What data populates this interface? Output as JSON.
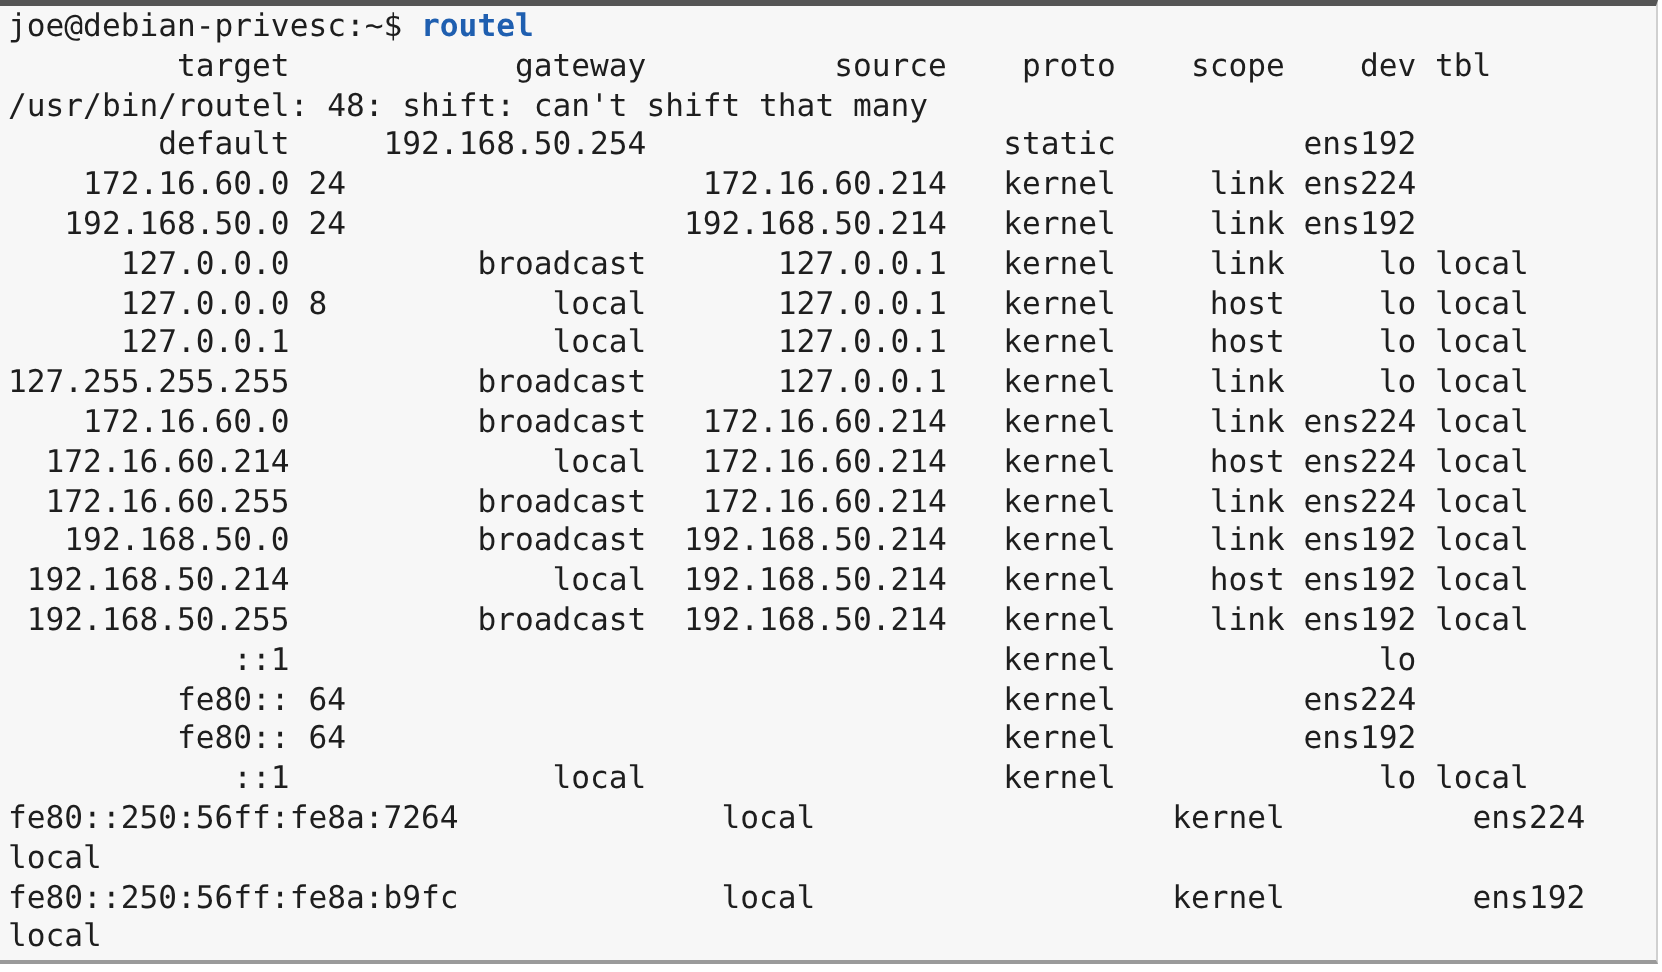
{
  "terminal": {
    "prompt": "joe@debian-privesc:~$",
    "command": "routel",
    "lines": [
      "         target            gateway          source    proto    scope    dev tbl",
      "/usr/bin/routel: 48: shift: can't shift that many",
      "        default     192.168.50.254                   static          ens192",
      "    172.16.60.0 24                   172.16.60.214   kernel     link ens224",
      "   192.168.50.0 24                  192.168.50.214   kernel     link ens192",
      "      127.0.0.0          broadcast       127.0.0.1   kernel     link     lo local",
      "      127.0.0.0 8            local       127.0.0.1   kernel     host     lo local",
      "      127.0.0.1              local       127.0.0.1   kernel     host     lo local",
      "127.255.255.255          broadcast       127.0.0.1   kernel     link     lo local",
      "    172.16.60.0          broadcast   172.16.60.214   kernel     link ens224 local",
      "  172.16.60.214              local   172.16.60.214   kernel     host ens224 local",
      "  172.16.60.255          broadcast   172.16.60.214   kernel     link ens224 local",
      "   192.168.50.0          broadcast  192.168.50.214   kernel     link ens192 local",
      " 192.168.50.214              local  192.168.50.214   kernel     host ens192 local",
      " 192.168.50.255          broadcast  192.168.50.214   kernel     link ens192 local",
      "            ::1                                      kernel              lo",
      "         fe80:: 64                                   kernel          ens224",
      "         fe80:: 64                                   kernel          ens192",
      "            ::1              local                   kernel              lo local",
      "fe80::250:56ff:fe8a:7264              local                   kernel          ens224",
      "local",
      "fe80::250:56ff:fe8a:b9fc              local                   kernel          ens192",
      "local"
    ]
  }
}
